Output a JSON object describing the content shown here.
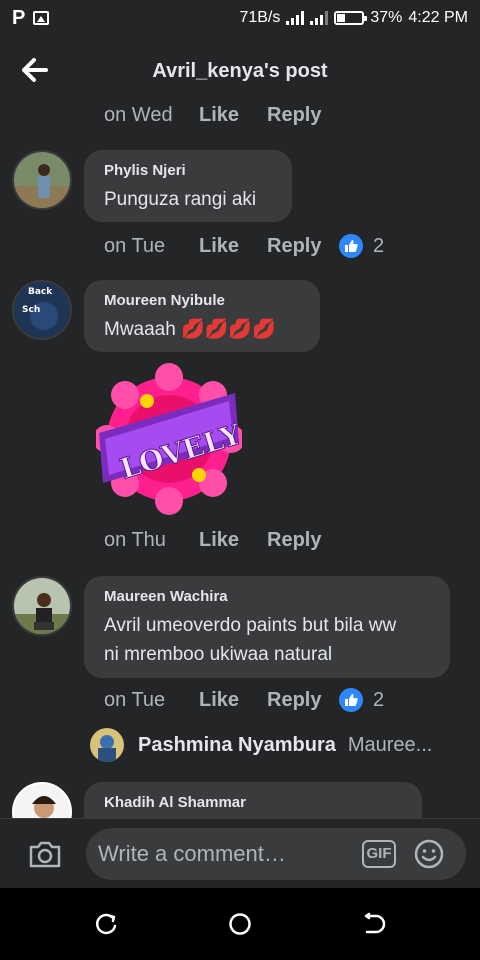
{
  "status_bar": {
    "net_speed": "71B/s",
    "battery_pct": "37%",
    "time": "4:22 PM"
  },
  "header": {
    "title": "Avril_kenya's post"
  },
  "comments": [
    {
      "time": "on Wed",
      "like": "Like",
      "reply": "Reply"
    },
    {
      "name": "Phylis Njeri",
      "text": "Punguza rangi aki",
      "time": "on Tue",
      "like": "Like",
      "reply": "Reply",
      "reactions": "2"
    },
    {
      "name": "Moureen Nyibule",
      "text": "Mwaaah",
      "emoji": "💋💋💋💋",
      "sticker_text": "LOVELY",
      "time": "on Thu",
      "like": "Like",
      "reply": "Reply"
    },
    {
      "name": "Maureen Wachira",
      "text_line1": "Avril umeoverdo paints but bila ww",
      "text_line2": "ni mremboo ukiwaa natural",
      "time": "on Tue",
      "like": "Like",
      "reply": "Reply",
      "reactions": "2"
    },
    {
      "name": "Khadih Al Shammar"
    }
  ],
  "reply_preview": {
    "name": "Pashmina Nyambura",
    "text": "Mauree..."
  },
  "composer": {
    "placeholder": "Write a comment…",
    "gif_label": "GIF"
  },
  "colors": {
    "background": "#242526",
    "bubble": "#3a3b3c",
    "accent_blue": "#2d88ff",
    "secondary_text": "#b0b3b8"
  }
}
